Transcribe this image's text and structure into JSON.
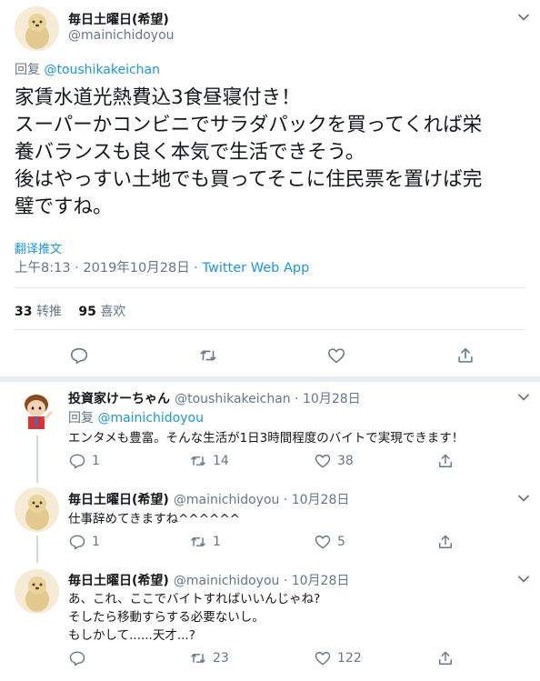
{
  "main_tweet": {
    "author_name": "毎日土曜日(希望)",
    "author_handle": "@mainichidoyou",
    "reply_prefix": "回复",
    "reply_to": "@toushikakeichan",
    "text_lines": [
      "家賃水道光熱費込3食昼寝付き！",
      "スーパーかコンビニでサラダパックを買ってくれば栄",
      "養バランスも良く本気で生活できそう。",
      "後はやっすい土地でも買ってそこに住民票を置けば完",
      "璧ですね。"
    ],
    "translate_label": "翻译推文",
    "meta_time": "上午8:13 · 2019年10月28日 · ",
    "meta_source": "Twitter Web App",
    "retweets": "33",
    "retweets_label": "转推",
    "likes": "95",
    "likes_label": "喜欢"
  },
  "replies": [
    {
      "author_name": "投資家けーちゃん",
      "author_handle": "@toushikakeichan · 10月28日",
      "reply_prefix": "回复",
      "reply_to": "@mainichidoyou",
      "text_lines": [
        "エンタメも豊富。そんな生活が1日3時間程度のバイトで実現できます！"
      ],
      "reply_count": "1",
      "retweet_count": "14",
      "like_count": "38"
    },
    {
      "author_name": "毎日土曜日(希望)",
      "author_handle": "@mainichidoyou · 10月28日",
      "text_lines": [
        "仕事辞めてきますね^^^^^^"
      ],
      "reply_count": "1",
      "retweet_count": "1",
      "like_count": "5"
    },
    {
      "author_name": "毎日土曜日(希望)",
      "author_handle": "@mainichidoyou · 10月28日",
      "text_lines": [
        "あ、これ、ここでバイトすればいいんじゃね?",
        "そしたら移動すらする必要ないし。",
        "もしかして......天才...?"
      ],
      "reply_count": "",
      "retweet_count": "23",
      "like_count": "122"
    }
  ],
  "colors": {
    "link": "#1b95e0",
    "muted": "#657786",
    "divider": "#e6ecf0"
  },
  "icons": [
    "chevron-down-icon",
    "reply-icon",
    "retweet-icon",
    "like-icon",
    "share-icon"
  ]
}
